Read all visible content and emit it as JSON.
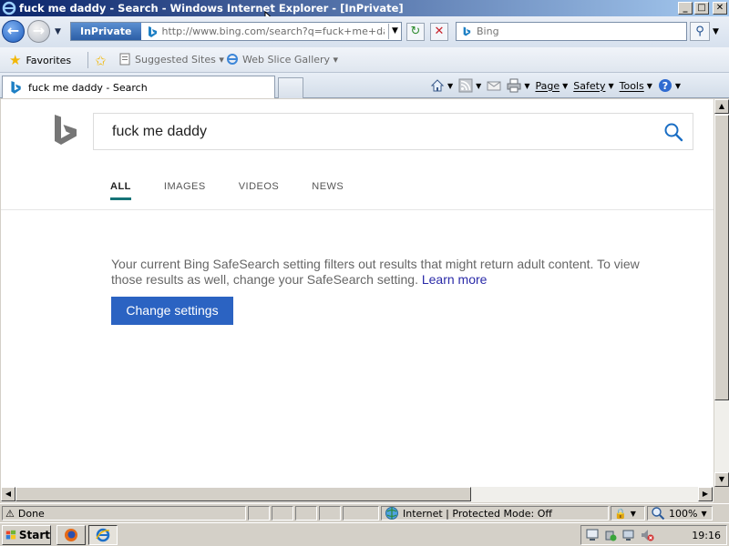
{
  "window": {
    "title": "fuck me daddy - Search - Windows Internet Explorer - [InPrivate]",
    "minimize_glyph": "_",
    "maximize_glyph": "□",
    "close_glyph": "✕"
  },
  "address_bar": {
    "inprivate_label": "InPrivate",
    "url": "http://www.bing.com/search?q=fuck+me+daddy&",
    "search_placeholder": "Bing"
  },
  "favorites_bar": {
    "favorites_label": "Favorites",
    "links": [
      {
        "label": "Suggested Sites ▾",
        "icon": "page-icon"
      },
      {
        "label": "Web Slice Gallery ▾",
        "icon": "ie-icon"
      }
    ]
  },
  "tabs": [
    {
      "label": "fuck me daddy - Search",
      "icon": "bing-icon",
      "active": true
    }
  ],
  "command_bar": {
    "items": [
      {
        "label": "Page",
        "icon": "page-icon"
      },
      {
        "label": "Safety",
        "icon": "safety-icon"
      },
      {
        "label": "Tools",
        "icon": "tools-icon"
      }
    ]
  },
  "bing": {
    "query": "fuck me daddy",
    "scopes": [
      {
        "label": "ALL",
        "active": true
      },
      {
        "label": "IMAGES",
        "active": false
      },
      {
        "label": "VIDEOS",
        "active": false
      },
      {
        "label": "NEWS",
        "active": false
      }
    ],
    "notice_text": "Your current Bing SafeSearch setting filters out results that might return adult content. To view those results as well, change your SafeSearch setting.",
    "learn_more": "Learn more",
    "change_settings": "Change settings",
    "accent_color": "#157377",
    "button_color": "#2b63c2"
  },
  "status_bar": {
    "status": "Done",
    "zone": "Internet | Protected Mode: Off",
    "zoom": "100%"
  },
  "taskbar": {
    "start_label": "Start",
    "clock": "19:16"
  }
}
